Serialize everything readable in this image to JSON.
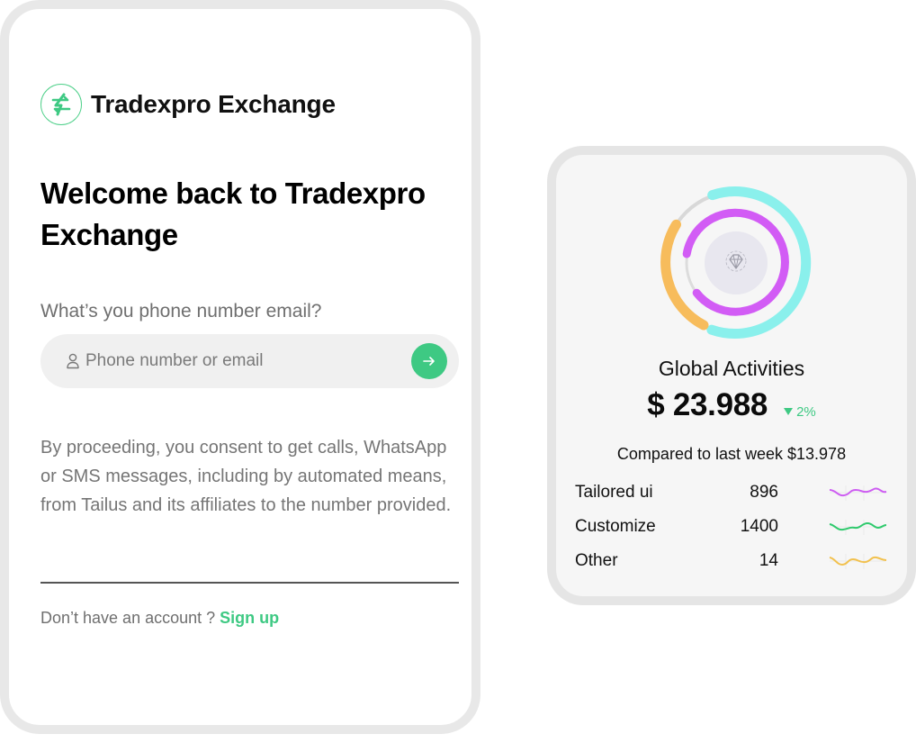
{
  "login": {
    "brand_name": "Tradexpro Exchange",
    "heading": "Welcome back to Tradexpro Exchange",
    "phone_label": "What’s you phone number email?",
    "input_placeholder": "Phone number or email",
    "input_value": "",
    "consent_text": "By proceeding, you consent to get calls, WhatsApp or SMS messages, including by automated means, from Tailus and its affiliates to the number provided.",
    "no_account_text": "Don’t have an account ? ",
    "signup_label": "Sign up",
    "accent_color": "#3ec983"
  },
  "stats": {
    "title": "Global Activities",
    "amount": "$ 23.988",
    "change": "2%",
    "change_direction": "down",
    "compare_text": "Compared to last week $13.978",
    "center_icon": "diamond-icon",
    "rows": [
      {
        "label": "Tailored ui",
        "value": "896",
        "color": "#cd5cf2"
      },
      {
        "label": "Customize",
        "value": "1400",
        "color": "#2fca6d"
      },
      {
        "label": "Other",
        "value": "14",
        "color": "#f2c14e"
      }
    ],
    "ring_colors": {
      "outer_primary": "#8af0ec",
      "outer_secondary": "#f7bc5c",
      "inner": "#d25cf5",
      "track": "#d8d8d8"
    }
  }
}
